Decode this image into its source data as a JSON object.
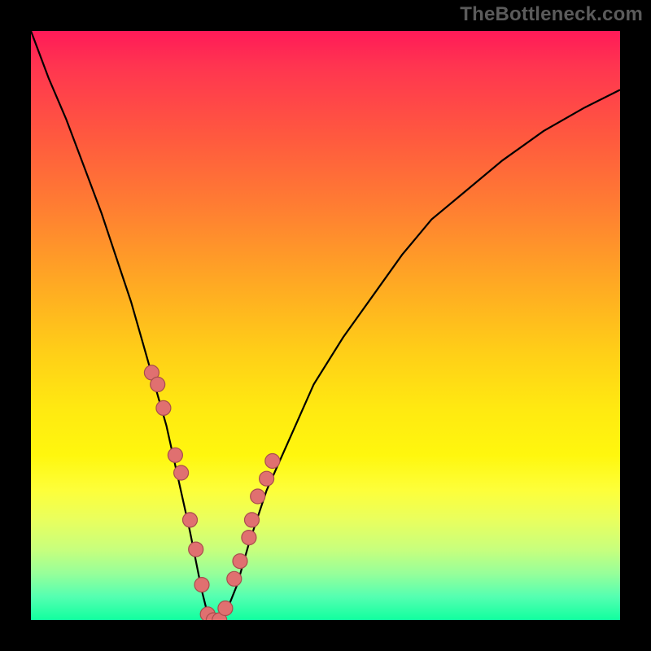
{
  "watermark": "TheBottleneck.com",
  "chart_data": {
    "type": "line",
    "title": "",
    "xlabel": "",
    "ylabel": "",
    "xlim": [
      0,
      100
    ],
    "ylim": [
      0,
      100
    ],
    "series": [
      {
        "name": "bottleneck-curve",
        "x": [
          0,
          3,
          6,
          9,
          12,
          15,
          17,
          19,
          21,
          23,
          25,
          27,
          29,
          30,
          31,
          32,
          33,
          35,
          37,
          40,
          44,
          48,
          53,
          58,
          63,
          68,
          74,
          80,
          87,
          94,
          100
        ],
        "y": [
          100,
          92,
          85,
          77,
          69,
          60,
          54,
          47,
          40,
          33,
          24,
          15,
          5,
          1,
          0,
          0,
          1,
          6,
          13,
          22,
          31,
          40,
          48,
          55,
          62,
          68,
          73,
          78,
          83,
          87,
          90
        ]
      }
    ],
    "markers": {
      "name": "data-points",
      "x": [
        20.5,
        21.5,
        22.5,
        24.5,
        25.5,
        27.0,
        28.0,
        29.0,
        30.0,
        31.0,
        32.0,
        33.0,
        34.5,
        35.5,
        37.0,
        37.5,
        38.5,
        40.0,
        41.0
      ],
      "y": [
        42,
        40,
        36,
        28,
        25,
        17,
        12,
        6,
        1,
        0,
        0,
        2,
        7,
        10,
        14,
        17,
        21,
        24,
        27
      ]
    }
  },
  "colors": {
    "background_frame": "#000000",
    "curve": "#000000",
    "marker_fill": "#e07070",
    "marker_stroke": "#a84d4d",
    "watermark": "#5b5b5b"
  }
}
